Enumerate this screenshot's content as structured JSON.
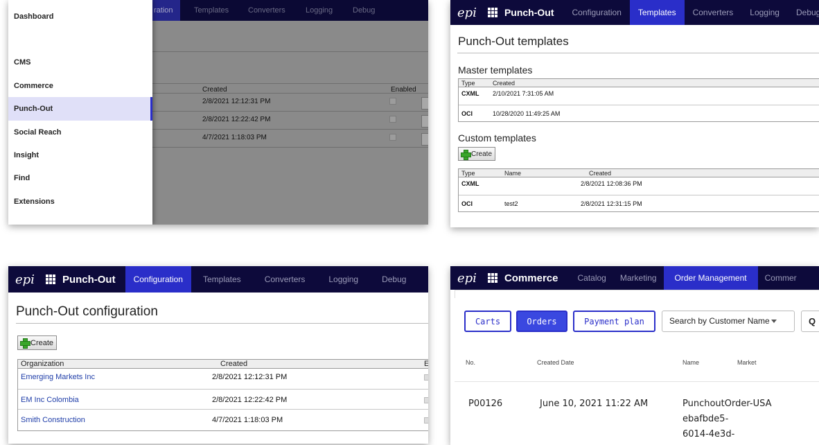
{
  "panel1": {
    "nav_tabs": [
      "ration",
      "Templates",
      "Converters",
      "Logging",
      "Debug"
    ],
    "table_headers": {
      "created": "Created",
      "enabled": "Enabled"
    },
    "rows": [
      {
        "created": "2/8/2021 12:12:31 PM"
      },
      {
        "created": "2/8/2021 12:22:42 PM"
      },
      {
        "created": "4/7/2021 1:18:03 PM"
      }
    ],
    "menu": [
      "Dashboard",
      "CMS",
      "Commerce",
      "Punch-Out",
      "Social Reach",
      "Insight",
      "Find",
      "Extensions"
    ],
    "active_menu": "Punch-Out"
  },
  "panel2": {
    "logo": "epi",
    "app": "Punch-Out",
    "tabs": [
      "Configuration",
      "Templates",
      "Converters",
      "Logging",
      "Debug"
    ],
    "active_tab": "Templates",
    "title": "Punch-Out templates",
    "master": {
      "heading": "Master templates",
      "headers": {
        "type": "Type",
        "created": "Created"
      },
      "rows": [
        {
          "type": "CXML",
          "created": "2/10/2021 7:31:05 AM"
        },
        {
          "type": "OCI",
          "created": "10/28/2020 11:49:25 AM"
        }
      ]
    },
    "custom": {
      "heading": "Custom templates",
      "create_label": "Create",
      "headers": {
        "type": "Type",
        "name": "Name",
        "created": "Created"
      },
      "rows": [
        {
          "type": "CXML",
          "name": "",
          "created": "2/8/2021 12:08:36 PM"
        },
        {
          "type": "OCI",
          "name": "test2",
          "created": "2/8/2021 12:31:15 PM"
        }
      ]
    }
  },
  "panel3": {
    "logo": "epi",
    "app": "Punch-Out",
    "tabs": [
      "Configuration",
      "Templates",
      "Converters",
      "Logging",
      "Debug"
    ],
    "active_tab": "Configuration",
    "title": "Punch-Out configuration",
    "create_label": "Create",
    "headers": {
      "organization": "Organization",
      "created": "Created",
      "e": "E"
    },
    "rows": [
      {
        "organization": "Emerging Markets Inc",
        "created": "2/8/2021 12:12:31 PM"
      },
      {
        "organization": "EM Inc Colombia",
        "created": "2/8/2021 12:22:42 PM"
      },
      {
        "organization": "Smith Construction",
        "created": "4/7/2021 1:18:03 PM"
      }
    ]
  },
  "panel4": {
    "logo": "epi",
    "app": "Commerce",
    "tabs": [
      "Catalog",
      "Marketing",
      "Order Management",
      "Commer"
    ],
    "active_tab": "Order Management",
    "buttons": {
      "carts": "Carts",
      "orders": "Orders",
      "payment_plan": "Payment plan"
    },
    "search_select": "Search by Customer Name",
    "q_label": "Q",
    "headers": {
      "no": "No.",
      "created_date": "Created Date",
      "name": "Name",
      "market": "Market"
    },
    "row": {
      "no": "P00126",
      "created_date": "June 10, 2021 11:22 AM",
      "name_lines": [
        "PunchoutOrder-USA",
        "ebafbde5-",
        "6014-4e3d-"
      ]
    }
  }
}
